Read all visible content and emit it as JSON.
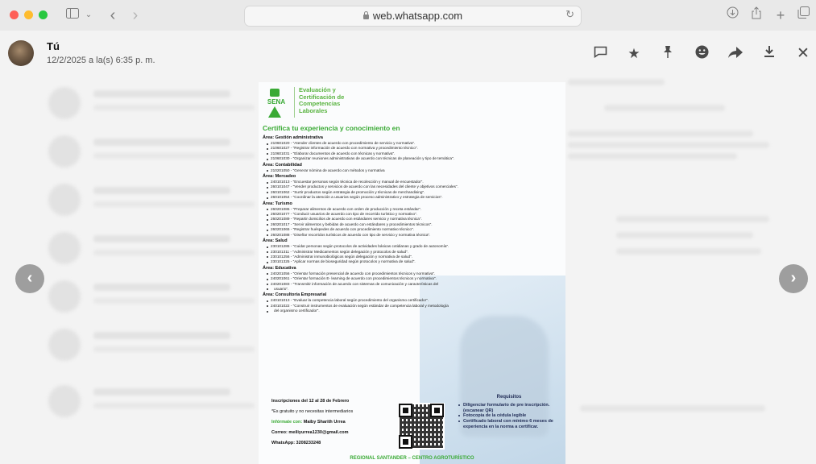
{
  "browser": {
    "url": "web.whatsapp.com",
    "traffic_lights": {
      "close": "#fe5f57",
      "minimize": "#febc2e",
      "maximize": "#28c840"
    },
    "icons": [
      "sidebar-icon",
      "chevron-down-icon",
      "back-icon",
      "forward-icon",
      "reload-icon",
      "download-icon",
      "share-icon",
      "new-tab-icon",
      "tabs-icon"
    ]
  },
  "header": {
    "sender": "Tú",
    "datetime": "12/2/2025 a la(s) 6:35 p. m.",
    "actions": [
      "reply-icon",
      "star-icon",
      "pin-icon",
      "react-icon",
      "forward-icon",
      "download-icon",
      "close-icon"
    ]
  },
  "navigation": {
    "prev": "‹",
    "next": "›"
  },
  "flyer": {
    "logo_text": "SENA",
    "logo_title": "Evaluación y Certificación de Competencias Laborales",
    "headline": "Certifica tu experiencia y conocimiento en",
    "areas": [
      {
        "title": "Área: Gestión administrativa",
        "items": [
          "210601020 - \"Atender clientes de acuerdo con procedimiento de servicio y normativa\".",
          "210601027 - \"Registrar información de acuerdo con normativa y procedimiento técnico\".",
          "210601031 - \"Elaborar documentos de acuerdo con técnicas y normativa\".",
          "210601030 - \"Organizar reuniones administrativas de acuerdo con técnicas de planeación y tipo de temática\"."
        ]
      },
      {
        "title": "Área: Contabilidad",
        "items": [
          "210201050 - \"Generar nómina de acuerdo con métodos y normativa"
        ]
      },
      {
        "title": "Área: Mercadeo",
        "items": [
          "240101013 - \"Encuestar personas según técnica de recolección y manual de encuestador\".",
          "260101047 - \"Vender productos y servicios de acuerdo con las necesidades del cliente y objetivos comerciales\".",
          "260101062 - \"Surtir productos según estrategia de promoción y técnicas de merchandising\".",
          "260101054 - \"Coordinar la atención a usuarios según proceso administrativo y estrategia de servicios\"."
        ]
      },
      {
        "title": "Área: Turismo",
        "items": [
          "260201086 - \"Preparar alimentos de acuerdo con orden de producción y receta estándar\".",
          "260201077 - \"Conducir usuarios de acuerdo con tipo de recorrido turístico y normativo\".",
          "260201089 - \"Repartir domicilios de acuerdo con estándares servicio y normativa técnica\".",
          "260201017 - \"Servir alimentos y bebidas de acuerdo con estándares y procedimientos técnicos\".",
          "260201065 - \"Registrar huéspedes de acuerdo con procedimiento normativo técnico\".",
          "260201088 - \"Diseñar recorridos turísticos de acuerdo con tipo de servicio y normativa técnica\"."
        ]
      },
      {
        "title": "Área: Salud",
        "items": [
          "230101286 - \"Cuidar personas según protocolos de actividades básicas cotidianas y grado de autonomía\".",
          "230101311 - \"Administrar Medicamentos según delegación y protocolos de salud\".",
          "230101256 - \"Administrar inmunobiológicos según delegación y normativa de salud\".",
          "230101325 - \"Aplicar normas de bioseguridad según protocolos y normativa de salud\"."
        ]
      },
      {
        "title": "Área: Educativa",
        "items": [
          "240201056 - \"Orientar formación presencial de acuerdo con procedimientos técnicos y normativa\".",
          "240201061 - \"Orientar formación E- learning de acuerdo con procedimientos técnicos y normativa\".",
          "240201083 - \"Transmitir información de acuerdo con sistemas de comunicación y características del",
          "usuario\"."
        ]
      },
      {
        "title": "Área: Consultoría Empresarial",
        "items": [
          "240101013 - \"Evaluar la competencia laboral según procedimiento del organismo certificador\".",
          "240101022 - \"Construir instrumentos de evaluación según estándar de competencia laboral y metodología",
          "del organismo certificador\"."
        ]
      }
    ],
    "inscriptions": "Inscripciones del 12 al 28 de Febrero",
    "free_note": "*Es gratuito y no necesitas intermediarios",
    "contact_label": "Infórmate con:",
    "contact_name": "Maiby Sharith Urrea",
    "email_line": "Correo: meiliyurrea1230@gmail.com",
    "whatsapp_line": "WhatsApp: 3208233248",
    "requirements_title": "Requisitos",
    "requirements": [
      "Diligenciar formulario de pre inscripción. (escanear QR)",
      "Fotocopia de la cédula legible",
      "Certificado laboral con mínimo 6 meses de experiencia en la norma a certificar."
    ],
    "footer": "REGIONAL SANTANDER – CENTRO AGROTURÍSTICO"
  }
}
